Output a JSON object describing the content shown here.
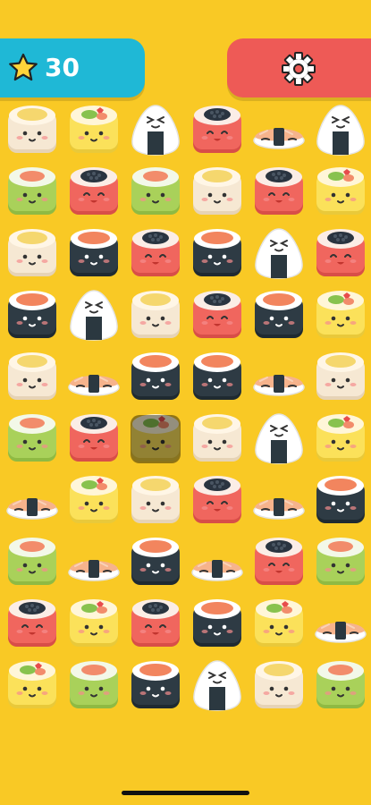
{
  "hud": {
    "score": "30",
    "score_icon": "star-icon",
    "settings_icon": "gear-icon"
  },
  "colors": {
    "background": "#F9C925",
    "score_panel": "#1FB8D6",
    "settings_panel": "#EE5A56"
  },
  "board": {
    "rows": 10,
    "cols": 6,
    "selected": {
      "row": 5,
      "col": 2
    },
    "pieces": [
      [
        "egg-roll",
        "yellow-roll",
        "onigiri",
        "salmon-roe-roll",
        "nigiri",
        "onigiri"
      ],
      [
        "green-roll",
        "salmon-roe-roll",
        "green-roll",
        "egg-roll",
        "salmon-roe-roll",
        "yellow-roll"
      ],
      [
        "egg-roll",
        "nori-roll",
        "salmon-roe-roll",
        "nori-roll",
        "onigiri",
        "salmon-roe-roll"
      ],
      [
        "nori-roll",
        "onigiri",
        "egg-roll",
        "salmon-roe-roll",
        "nori-roll",
        "yellow-roll"
      ],
      [
        "egg-roll",
        "nigiri",
        "nori-roll",
        "nori-roll",
        "nigiri",
        "egg-roll"
      ],
      [
        "green-roll",
        "salmon-roe-roll",
        "yellow-roll",
        "egg-roll",
        "onigiri",
        "yellow-roll"
      ],
      [
        "nigiri",
        "yellow-roll",
        "egg-roll",
        "salmon-roe-roll",
        "nigiri",
        "nori-roll"
      ],
      [
        "green-roll",
        "nigiri",
        "nori-roll",
        "nigiri",
        "salmon-roe-roll",
        "green-roll"
      ],
      [
        "salmon-roe-roll",
        "yellow-roll",
        "salmon-roe-roll",
        "nori-roll",
        "yellow-roll",
        "nigiri"
      ],
      [
        "yellow-roll",
        "green-roll",
        "nori-roll",
        "onigiri",
        "egg-roll",
        "green-roll"
      ]
    ]
  }
}
